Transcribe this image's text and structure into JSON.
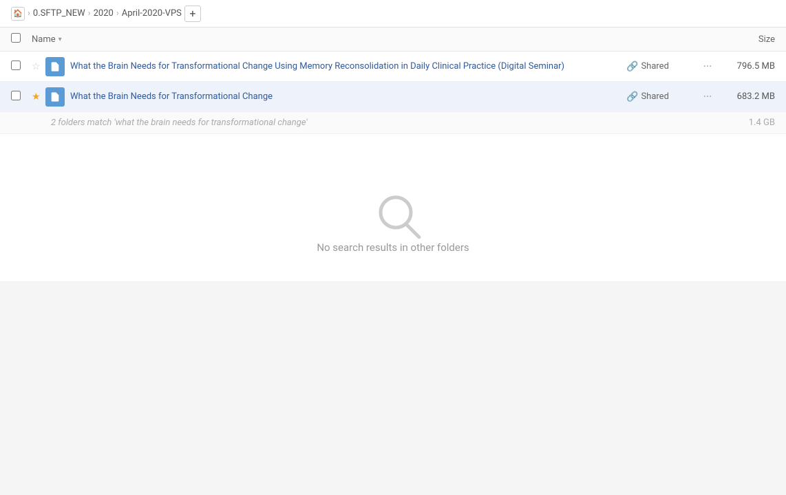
{
  "breadcrumb": {
    "home_icon": "🏠",
    "items": [
      {
        "label": "0.SFTP_NEW",
        "id": "sftp-new"
      },
      {
        "label": "2020",
        "id": "2020"
      },
      {
        "label": "April-2020-VPS",
        "id": "april-2020-vps"
      }
    ],
    "add_tab_label": "+"
  },
  "list_header": {
    "name_label": "Name",
    "sort_icon": "▾",
    "size_label": "Size"
  },
  "files": [
    {
      "id": "file-1",
      "name": "What the Brain Needs for Transformational Change Using Memory Reconsolidation in Daily Clinical Practice (Digital Seminar)",
      "shared_label": "Shared",
      "size": "796.5 MB",
      "starred": false,
      "icon_color": "#5b9bd5"
    },
    {
      "id": "file-2",
      "name": "What the Brain Needs for Transformational Change",
      "shared_label": "Shared",
      "size": "683.2 MB",
      "starred": true,
      "icon_color": "#5b9bd5",
      "active": true
    }
  ],
  "match_info": {
    "text": "2 folders match 'what the brain needs for transformational change'",
    "size": "1.4 GB"
  },
  "empty_state": {
    "message": "No search results in other folders"
  }
}
